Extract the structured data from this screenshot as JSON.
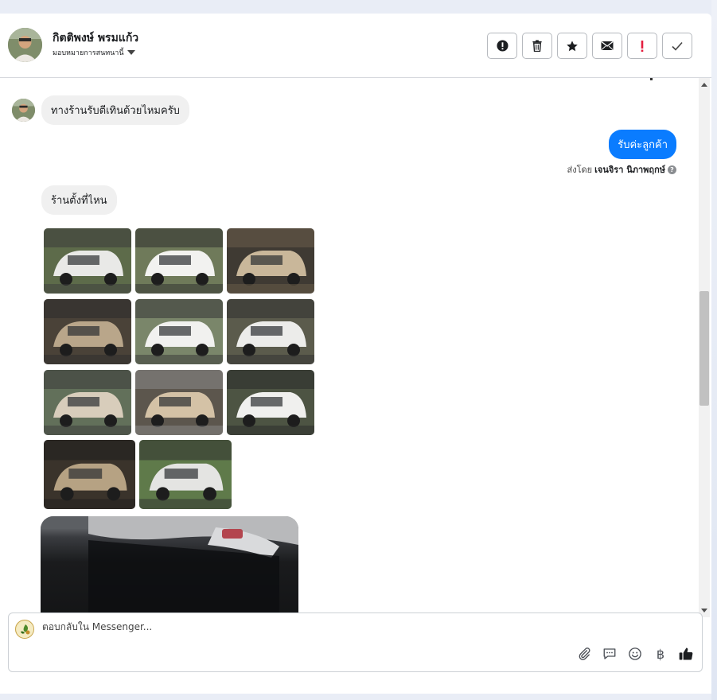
{
  "header": {
    "contact_name": "กิตติพงษ์ พรมแก้ว",
    "assign_label": "มอบหมายการสนทนานี้",
    "toolbar": [
      {
        "name": "spam-button",
        "glyph": "!"
      },
      {
        "name": "delete-button",
        "glyph": ""
      },
      {
        "name": "star-button",
        "glyph": "★"
      },
      {
        "name": "mark-unread-button",
        "glyph": ""
      },
      {
        "name": "follow-up-button",
        "glyph": "!"
      },
      {
        "name": "mark-done-button",
        "glyph": "✓"
      }
    ]
  },
  "messages": {
    "incoming_1": "ทางร้านรับตีเทินด้วยไหมครับ",
    "outgoing_1": "รับค่ะลูกค้า",
    "sent_by_prefix": "ส่งโดย",
    "sent_by_name": "เจนจิรา นิภาพฤกษ์",
    "incoming_2": "ร้านตั้งที่ไหน",
    "photo_count": 11
  },
  "reply_box": {
    "placeholder": "ตอบกลับใน Messenger...",
    "icons": [
      "attachment-icon",
      "saved-reply-icon",
      "emoji-icon",
      "baht-payment-icon",
      "like-icon"
    ]
  },
  "colors": {
    "outgoing_bubble": "#0a7cff",
    "incoming_bubble": "#f0f0f0",
    "follow_up_red": "#e41e3f"
  }
}
